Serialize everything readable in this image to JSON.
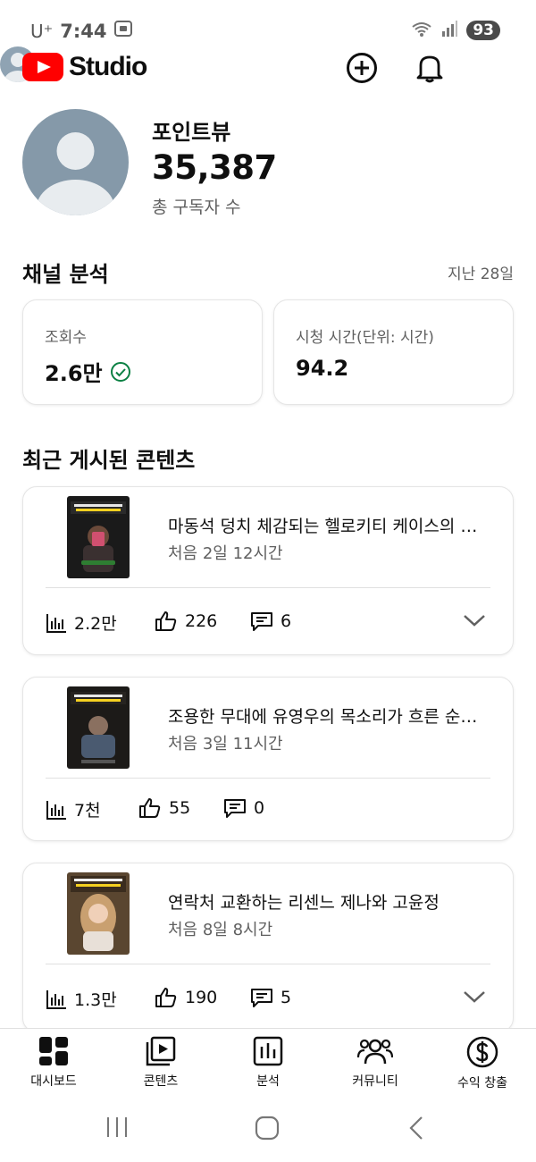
{
  "status_bar": {
    "carrier": "U⁺",
    "time": "7:44",
    "battery": "93"
  },
  "app": {
    "title": "Studio",
    "icons": [
      "create-icon",
      "bell-icon",
      "account-avatar"
    ]
  },
  "channel": {
    "name": "포인트뷰",
    "subscribers": "35,387",
    "subscribers_label": "총 구독자 수"
  },
  "analytics": {
    "title": "채널 분석",
    "period": "지난 28일",
    "metrics": [
      {
        "label": "조회수",
        "value": "2.6만",
        "status_icon": "check-circle-icon"
      },
      {
        "label": "시청 시간(단위: 시간)",
        "value": "94.2"
      }
    ]
  },
  "recent": {
    "title": "최근 게시된 콘텐츠",
    "items": [
      {
        "title": "마동석 덩치 체감되는 헬로키티 케이스의 …",
        "age": "처음 2일 12시간",
        "views": "2.2만",
        "likes": "226",
        "comments": "6",
        "expandable": true
      },
      {
        "title": "조용한 무대에 유영우의 목소리가 흐른 순…",
        "age": "처음 3일 11시간",
        "views": "7천",
        "likes": "55",
        "comments": "0",
        "expandable": false
      },
      {
        "title": "연락처 교환하는 리센느 제나와 고윤정",
        "age": "처음 8일 8시간",
        "views": "1.3만",
        "likes": "190",
        "comments": "5",
        "expandable": true
      }
    ]
  },
  "nav": {
    "items": [
      {
        "label": "대시보드",
        "icon": "dashboard-icon"
      },
      {
        "label": "콘텐츠",
        "icon": "content-icon"
      },
      {
        "label": "분석",
        "icon": "analytics-icon"
      },
      {
        "label": "커뮤니티",
        "icon": "community-icon"
      },
      {
        "label": "수익 창출",
        "icon": "monetization-icon"
      }
    ]
  },
  "colors": {
    "brand": "#ff0000",
    "success": "#0b8043",
    "text": "#0f0f0f",
    "muted": "#606060"
  }
}
